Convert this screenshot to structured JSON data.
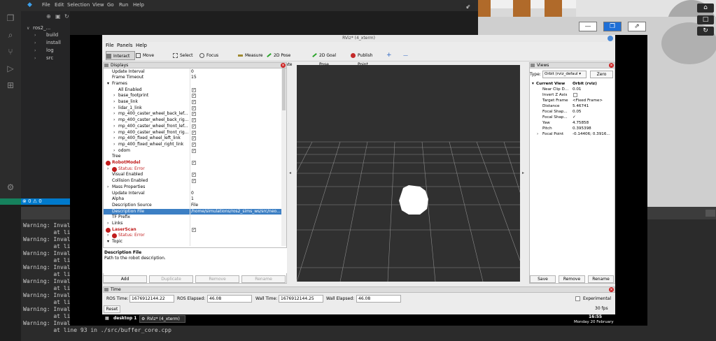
{
  "vscode": {
    "menu": [
      "File",
      "Edit",
      "Selection",
      "View",
      "Go",
      "Run",
      "Help"
    ],
    "explorer": {
      "root": "ros2_...",
      "items": [
        "build",
        "install",
        "log",
        "src"
      ]
    },
    "status": "⊗ 0  ⚠ 0"
  },
  "scene_controls": {
    "minimize": "—",
    "restore": "❐",
    "fullscreen": "⇗",
    "side": [
      "⌂",
      "□",
      "↻",
      "▢"
    ]
  },
  "terminal": {
    "lines": [
      "Warning: Inval",
      "         at li",
      "Warning: Inval",
      "         at li",
      "Warning: Inval",
      "         at li",
      "Warning: Inval",
      "         at li",
      "Warning: Inval",
      "         at li",
      "Warning: Inval",
      "         at li",
      "Warning: Inval",
      "         at li",
      "Warning: Inval",
      "         at line 93 in ./src/buffer_core.cpp"
    ]
  },
  "rviz": {
    "title": "RViz* (4_xterm)",
    "menu": [
      "File",
      "Panels",
      "Help"
    ],
    "toolbar": [
      "Interact",
      "Move Camera",
      "Select",
      "Focus Camera",
      "Measure",
      "2D Pose Estimate",
      "2D Goal Pose",
      "Publish Point",
      "+",
      "—"
    ],
    "displays": {
      "title": "Displays",
      "rows": [
        {
          "name": "Update Interval",
          "value": "0"
        },
        {
          "name": "Frame Timeout",
          "value": "15"
        },
        {
          "name": "Frames",
          "value": ""
        },
        {
          "name": "All Enabled",
          "check": "✓"
        },
        {
          "name": "base_footprint",
          "check": "✓"
        },
        {
          "name": "base_link",
          "check": "✓"
        },
        {
          "name": "lidar_1_link",
          "check": "✓"
        },
        {
          "name": "mp_400_caster_wheel_back_lef...",
          "check": "✓"
        },
        {
          "name": "mp_400_caster_wheel_back_rig...",
          "check": "✓"
        },
        {
          "name": "mp_400_caster_wheel_front_lef...",
          "check": "✓"
        },
        {
          "name": "mp_400_caster_wheel_front_rig...",
          "check": "✓"
        },
        {
          "name": "mp_400_fixed_wheel_left_link",
          "check": "✓"
        },
        {
          "name": "mp_400_fixed_wheel_right_link",
          "check": "✓"
        },
        {
          "name": "odom",
          "check": "✓"
        },
        {
          "name": "Tree",
          "value": ""
        },
        {
          "name": "RobotModel",
          "check": "✓"
        },
        {
          "name": "Status: Error",
          "value": ""
        },
        {
          "name": "Visual Enabled",
          "check": "✓"
        },
        {
          "name": "Collision Enabled",
          "check": "✓"
        },
        {
          "name": "Mass Properties",
          "value": ""
        },
        {
          "name": "Update Interval",
          "value": "0"
        },
        {
          "name": "Alpha",
          "value": "1"
        },
        {
          "name": "Description Source",
          "value": "File"
        },
        {
          "name": "Description File",
          "value": "/home/simulations/ros2_sims_ws/src/neo..."
        },
        {
          "name": "TF Prefix",
          "value": ""
        },
        {
          "name": "Links",
          "value": ""
        },
        {
          "name": "LaserScan",
          "check": "✓"
        },
        {
          "name": "Status: Error",
          "value": ""
        },
        {
          "name": "Topic",
          "value": ""
        }
      ],
      "desc_title": "Description File",
      "desc_text": "Path to the robot description.",
      "buttons": [
        "Add",
        "Duplicate",
        "Remove",
        "Rename"
      ]
    },
    "views": {
      "title": "Views",
      "type_label": "Type:",
      "type_value": "Orbit (rviz_defaul ▾",
      "zero": "Zero",
      "rows": [
        {
          "name": "Current View",
          "value": "Orbit (rviz)"
        },
        {
          "name": "Near Clip D...",
          "value": "0.01"
        },
        {
          "name": "Invert Z Axis",
          "value": ""
        },
        {
          "name": "Target Frame",
          "value": "<Fixed Frame>"
        },
        {
          "name": "Distance",
          "value": "5.46741"
        },
        {
          "name": "Focal Shap...",
          "value": "0.05"
        },
        {
          "name": "Focal Shap...",
          "value": "✓"
        },
        {
          "name": "Yaw",
          "value": "4.75858"
        },
        {
          "name": "Pitch",
          "value": "0.395398"
        },
        {
          "name": "Focal Point",
          "value": "-0.14406; 0.3916..."
        }
      ],
      "buttons": [
        "Save",
        "Remove",
        "Rename"
      ]
    },
    "time": {
      "title": "Time",
      "ros_time_label": "ROS Time:",
      "ros_time": "1676912144.22",
      "ros_elapsed_label": "ROS Elapsed:",
      "ros_elapsed": "46.08",
      "wall_time_label": "Wall Time:",
      "wall_time": "1676912144.25",
      "wall_elapsed_label": "Wall Elapsed:",
      "wall_elapsed": "46.08",
      "experimental": "Experimental",
      "reset": "Reset",
      "fps": "30 fps"
    },
    "taskbar": {
      "desktop": "desktop 1",
      "window": "RViz* (4_xterm)",
      "clock": "16:55",
      "date": "Monday 20 February"
    }
  }
}
